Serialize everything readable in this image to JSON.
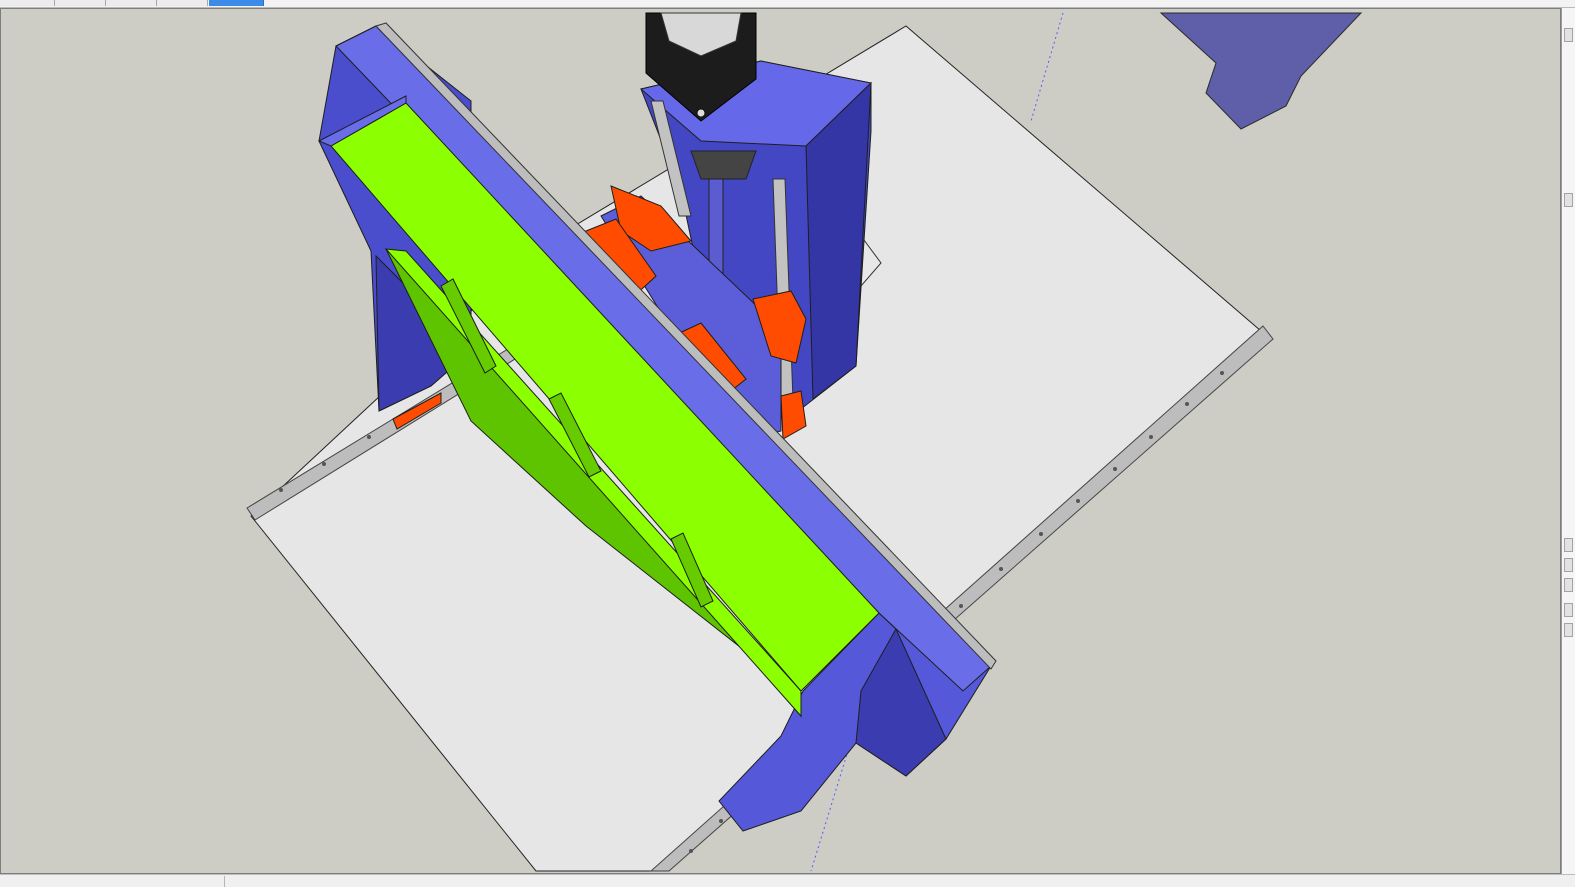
{
  "toolbar": {
    "scene_tabs": [
      {
        "label": "",
        "active": false
      },
      {
        "label": "",
        "active": false
      },
      {
        "label": "",
        "active": false
      },
      {
        "label": "",
        "active": false
      },
      {
        "label": "",
        "active": true
      }
    ]
  },
  "viewport": {
    "model_parts": [
      "aluminium-bed-plate",
      "front-linear-rail",
      "rear-linear-rail",
      "gantry-side-plate-left",
      "gantry-side-plate-right",
      "gantry-beam",
      "gantry-top-face",
      "gantry-linear-rail",
      "z-axis-carriage",
      "z-axis-motor-mount",
      "stepper-motor",
      "bearing-block",
      "lead-screw",
      "z-axis-rail"
    ],
    "colors": {
      "background": "#cdcdc6",
      "bed_plate": "#e6e6e6",
      "frame_blue": "#6366e6",
      "frame_blue_dark": "#3b3db8",
      "gantry_green": "#8cff00",
      "gantry_green_dark": "#5fc400",
      "bearing_orange": "#ff4c00",
      "rail_steel": "#bdbdbd",
      "motor_black": "#1c1c1c"
    }
  },
  "side_panel": {
    "icons": [
      "scroll-up-icon",
      "panel-button-icon",
      "panel-button-icon",
      "panel-button-icon",
      "panel-button-icon",
      "panel-button-icon",
      "panel-button-icon"
    ]
  },
  "status": {
    "text": ""
  }
}
